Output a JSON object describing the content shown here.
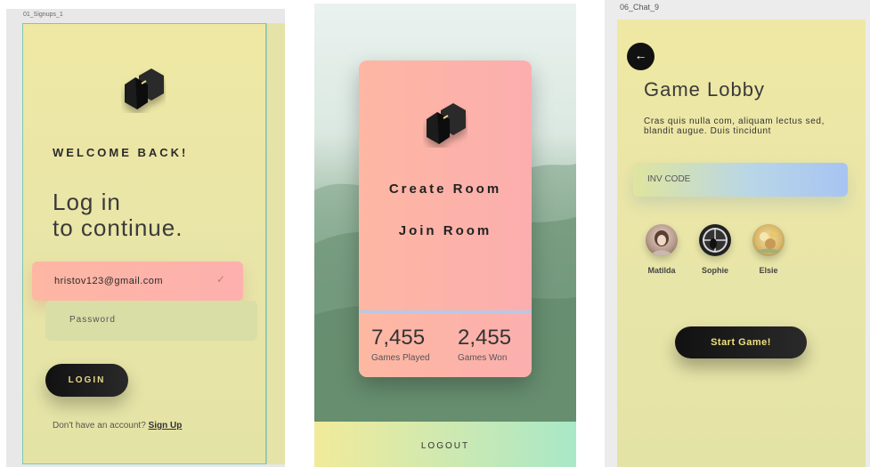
{
  "screen1": {
    "artboard_label": "01_Signups_1",
    "welcome": "WELCOME BACK!",
    "title_line1": "Log in",
    "title_line2": "to continue.",
    "email_value": "hristov123@gmail.com",
    "password_placeholder": "Password",
    "login_label": "LOGIN",
    "signup_prompt": "Don't have an account?",
    "signup_link": "Sign Up"
  },
  "screen2": {
    "create_room": "Create Room",
    "join_room": "Join Room",
    "stats": [
      {
        "value": "7,455",
        "label": "Games Played"
      },
      {
        "value": "2,455",
        "label": "Games Won"
      }
    ],
    "logout_label": "LOGOUT"
  },
  "screen3": {
    "artboard_label": "06_Chat_9",
    "back_icon": "←",
    "title": "Game Lobby",
    "description": "Cras quis nulla com, aliquam lectus sed, blandit augue. Duis tincidunt",
    "invite_placeholder": "INV CODE",
    "players": [
      {
        "name": "Matilda"
      },
      {
        "name": "Sophie"
      },
      {
        "name": "Elsie"
      }
    ],
    "start_label": "Start Game!"
  },
  "colors": {
    "yellow_bg": "#efe8a4",
    "peach": "#fdb7a3",
    "pink": "#fcaeae",
    "dark": "#111111",
    "gold_text": "#f1e27e"
  },
  "icons": [
    "logo-icon",
    "check-icon",
    "back-arrow-icon"
  ]
}
